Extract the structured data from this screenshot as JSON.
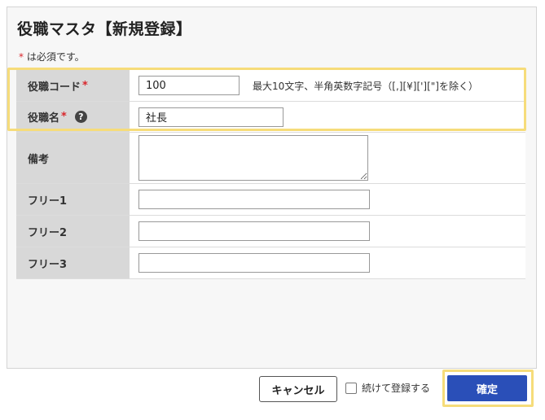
{
  "page": {
    "title": "役職マスタ【新規登録】",
    "required_mark": "*",
    "required_note": " は必須です。"
  },
  "form": {
    "position_code": {
      "label": "役職コード",
      "required_mark": "*",
      "value": "100",
      "hint": "最大10文字、半角英数字記号（[,][¥]['][\"]を除く）"
    },
    "position_name": {
      "label": "役職名",
      "required_mark": "*",
      "help_glyph": "?",
      "value": "社長"
    },
    "remarks": {
      "label": "備考",
      "value": ""
    },
    "free1": {
      "label": "フリー1",
      "value": ""
    },
    "free2": {
      "label": "フリー2",
      "value": ""
    },
    "free3": {
      "label": "フリー3",
      "value": ""
    }
  },
  "footer": {
    "cancel_label": "キャンセル",
    "continue_label": "続けて登録する",
    "confirm_label": "確定"
  },
  "colors": {
    "accent": "#2a4fb8",
    "highlight": "#f6dc7a",
    "required": "#d9262c",
    "label_bg": "#d8d8d8"
  },
  "icons": [
    "help-icon",
    "checkbox-icon"
  ]
}
